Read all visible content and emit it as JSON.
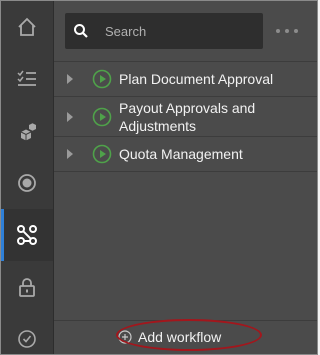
{
  "rail": {
    "items": [
      {
        "name": "home",
        "icon": "home-icon",
        "active": false
      },
      {
        "name": "tasks",
        "icon": "checklist-icon",
        "active": false
      },
      {
        "name": "components",
        "icon": "cubes-icon",
        "active": false
      },
      {
        "name": "status",
        "icon": "radio-circle-icon",
        "active": false
      },
      {
        "name": "workflow",
        "icon": "workflow-icon",
        "active": true
      },
      {
        "name": "security",
        "icon": "lock-icon",
        "active": false
      },
      {
        "name": "history",
        "icon": "clock-icon",
        "active": false
      }
    ],
    "accent": "#2f80d8"
  },
  "search": {
    "placeholder": "Search",
    "value": ""
  },
  "workflows": [
    {
      "label": "Plan Document Approval",
      "icon": "play-circle-icon"
    },
    {
      "label": "Payout Approvals and Adjustments",
      "icon": "play-circle-icon"
    },
    {
      "label": "Quota Management",
      "icon": "play-circle-icon"
    }
  ],
  "footer": {
    "add_label": "Add workflow",
    "add_icon": "plus-circle-icon",
    "highlight_color": "#a3161c"
  },
  "colors": {
    "play": "#4fa24a",
    "panel": "#4b4b4b",
    "rail": "#3a3a3a"
  }
}
